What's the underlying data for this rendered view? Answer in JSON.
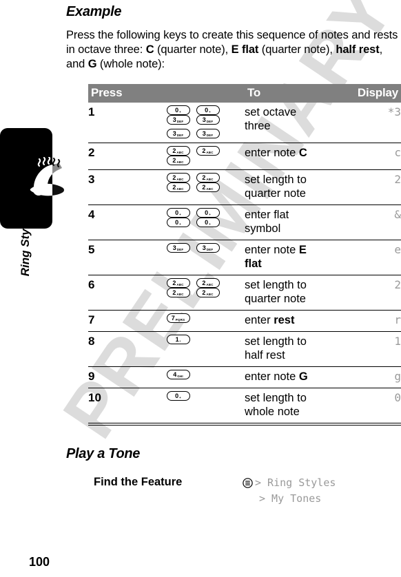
{
  "chapter": {
    "label": "Ring Styles",
    "icon": "bell-icon"
  },
  "page_number": "100",
  "watermark": "PRELIMINARY",
  "sections": {
    "example": {
      "heading": "Example",
      "intro_parts": [
        "Press the following keys to create this sequence of notes and rests in octave three: ",
        "C",
        " (quarter note), ",
        "E flat",
        " (quarter note), ",
        "half rest",
        ", and ",
        "G",
        " (whole note):"
      ]
    },
    "play_a_tone": {
      "heading": "Play a Tone",
      "find_the_feature_label": "Find the Feature",
      "menu_icon": "menu-circle-icon",
      "path": [
        "> Ring Styles",
        "> My Tones"
      ]
    }
  },
  "table": {
    "headers": {
      "press": "Press",
      "to": "To",
      "display": "Display"
    },
    "header_bg": "#808080",
    "header_fg": "#ffffff",
    "display_color": "#9a9a9a",
    "rows": [
      {
        "num": "1",
        "keys": [
          [
            {
              "digit": "0",
              "sub": "+"
            },
            {
              "digit": "0",
              "sub": "+"
            },
            {
              "digit": "3",
              "sub": "DEF"
            },
            {
              "digit": "3",
              "sub": "DEF"
            }
          ],
          [
            {
              "digit": "3",
              "sub": "DEF"
            },
            {
              "digit": "3",
              "sub": "DEF"
            }
          ]
        ],
        "to": "set octave three",
        "to_bold": "",
        "display": "*3"
      },
      {
        "num": "2",
        "keys": [
          [
            {
              "digit": "2",
              "sub": "ABC"
            },
            {
              "digit": "2",
              "sub": "ABC"
            },
            {
              "digit": "2",
              "sub": "ABC"
            }
          ]
        ],
        "to": "enter note ",
        "to_bold": "C",
        "display": "c"
      },
      {
        "num": "3",
        "keys": [
          [
            {
              "digit": "2",
              "sub": "ABC"
            },
            {
              "digit": "2",
              "sub": "ABC"
            },
            {
              "digit": "2",
              "sub": "ABC"
            },
            {
              "digit": "2",
              "sub": "ABC"
            }
          ]
        ],
        "to": "set length to quarter note",
        "to_bold": "",
        "display": "2"
      },
      {
        "num": "4",
        "keys": [
          [
            {
              "digit": "0",
              "sub": "+"
            },
            {
              "digit": "0",
              "sub": "+"
            },
            {
              "digit": "0",
              "sub": "+"
            },
            {
              "digit": "0",
              "sub": "+"
            }
          ]
        ],
        "to": "enter flat symbol",
        "to_bold": "",
        "display": "&"
      },
      {
        "num": "5",
        "keys": [
          [
            {
              "digit": "3",
              "sub": "DEF"
            },
            {
              "digit": "3",
              "sub": "DEF"
            }
          ]
        ],
        "to": "enter note ",
        "to_bold": "E flat",
        "display": "e"
      },
      {
        "num": "6",
        "keys": [
          [
            {
              "digit": "2",
              "sub": "ABC"
            },
            {
              "digit": "2",
              "sub": "ABC"
            },
            {
              "digit": "2",
              "sub": "ABC"
            },
            {
              "digit": "2",
              "sub": "ABC"
            }
          ]
        ],
        "to": "set length to quarter note",
        "to_bold": "",
        "display": "2"
      },
      {
        "num": "7",
        "keys": [
          [
            {
              "digit": "7",
              "sub": "PQRS"
            }
          ]
        ],
        "to": "enter ",
        "to_bold": "rest",
        "display": "r"
      },
      {
        "num": "8",
        "keys": [
          [
            {
              "digit": "1",
              "sub": "•"
            }
          ]
        ],
        "to": "set length to half rest",
        "to_bold": "",
        "display": "1"
      },
      {
        "num": "9",
        "keys": [
          [
            {
              "digit": "4",
              "sub": "GHI"
            }
          ]
        ],
        "to": "enter note ",
        "to_bold": "G",
        "display": "g"
      },
      {
        "num": "10",
        "keys": [
          [
            {
              "digit": "0",
              "sub": "+"
            }
          ]
        ],
        "to": "set length to whole note",
        "to_bold": "",
        "display": "0"
      }
    ]
  }
}
